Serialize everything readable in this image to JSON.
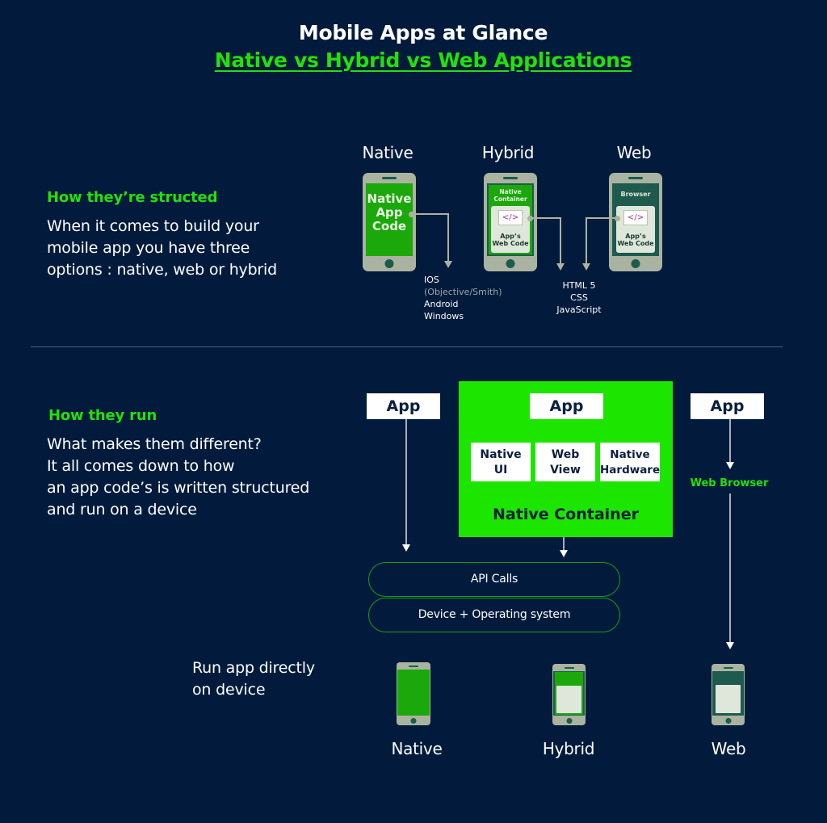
{
  "header": {
    "title": "Mobile Apps at Glance",
    "subtitle": "Native vs Hybrid vs Web Applications"
  },
  "structure_section": {
    "heading": "How they’re structed",
    "body_lines": [
      "When it comes to build your",
      "mobile app you have three",
      "options : native, web or hybrid"
    ],
    "columns": [
      {
        "label": "Native",
        "phone_screen_text": [
          "Native",
          "App",
          "Code"
        ]
      },
      {
        "label": "Hybrid",
        "phone_top_text": [
          "Native",
          "Container"
        ],
        "code_icon": "</>",
        "phone_box_text": [
          "App’s",
          "Web Code"
        ]
      },
      {
        "label": "Web",
        "phone_top_text": [
          "Browser"
        ],
        "code_icon": "</>",
        "phone_box_text": [
          "App’s",
          "Web Code"
        ]
      }
    ],
    "native_languages": {
      "items": [
        "IOS",
        "(Objective/Smith)",
        "Android",
        "Windows"
      ]
    },
    "web_languages": {
      "items": [
        "HTML 5",
        "CSS",
        "JavaScript"
      ]
    }
  },
  "run_section": {
    "heading": "How they run",
    "body_lines": [
      "What makes them different?",
      "It all comes down to how",
      "an app code’s is written structured",
      "and run on a device"
    ],
    "native_app_label": "App",
    "container": {
      "app_label": "App",
      "components": [
        {
          "line1": "Native",
          "line2": "UI"
        },
        {
          "line1": "Web",
          "line2": "View"
        },
        {
          "line1": "Native",
          "line2": "Hardware"
        }
      ],
      "label": "Native Container"
    },
    "web_app_label": "App",
    "web_browser_label": "Web Browser",
    "layers": [
      "API Calls",
      "Device + Operating system"
    ],
    "run_directly_lines": [
      "Run app directly",
      "on device"
    ],
    "bottom_labels": [
      "Native",
      "Hybrid",
      "Web"
    ]
  },
  "colors": {
    "background": "#021b3c",
    "accent_green": "#22e10a",
    "container_green": "#1ce600",
    "phone_green": "#1aa80a",
    "phone_dark_teal": "#1e5a4e",
    "phone_frame": "#a9b3a0",
    "pill_border": "#1a9a1a"
  }
}
